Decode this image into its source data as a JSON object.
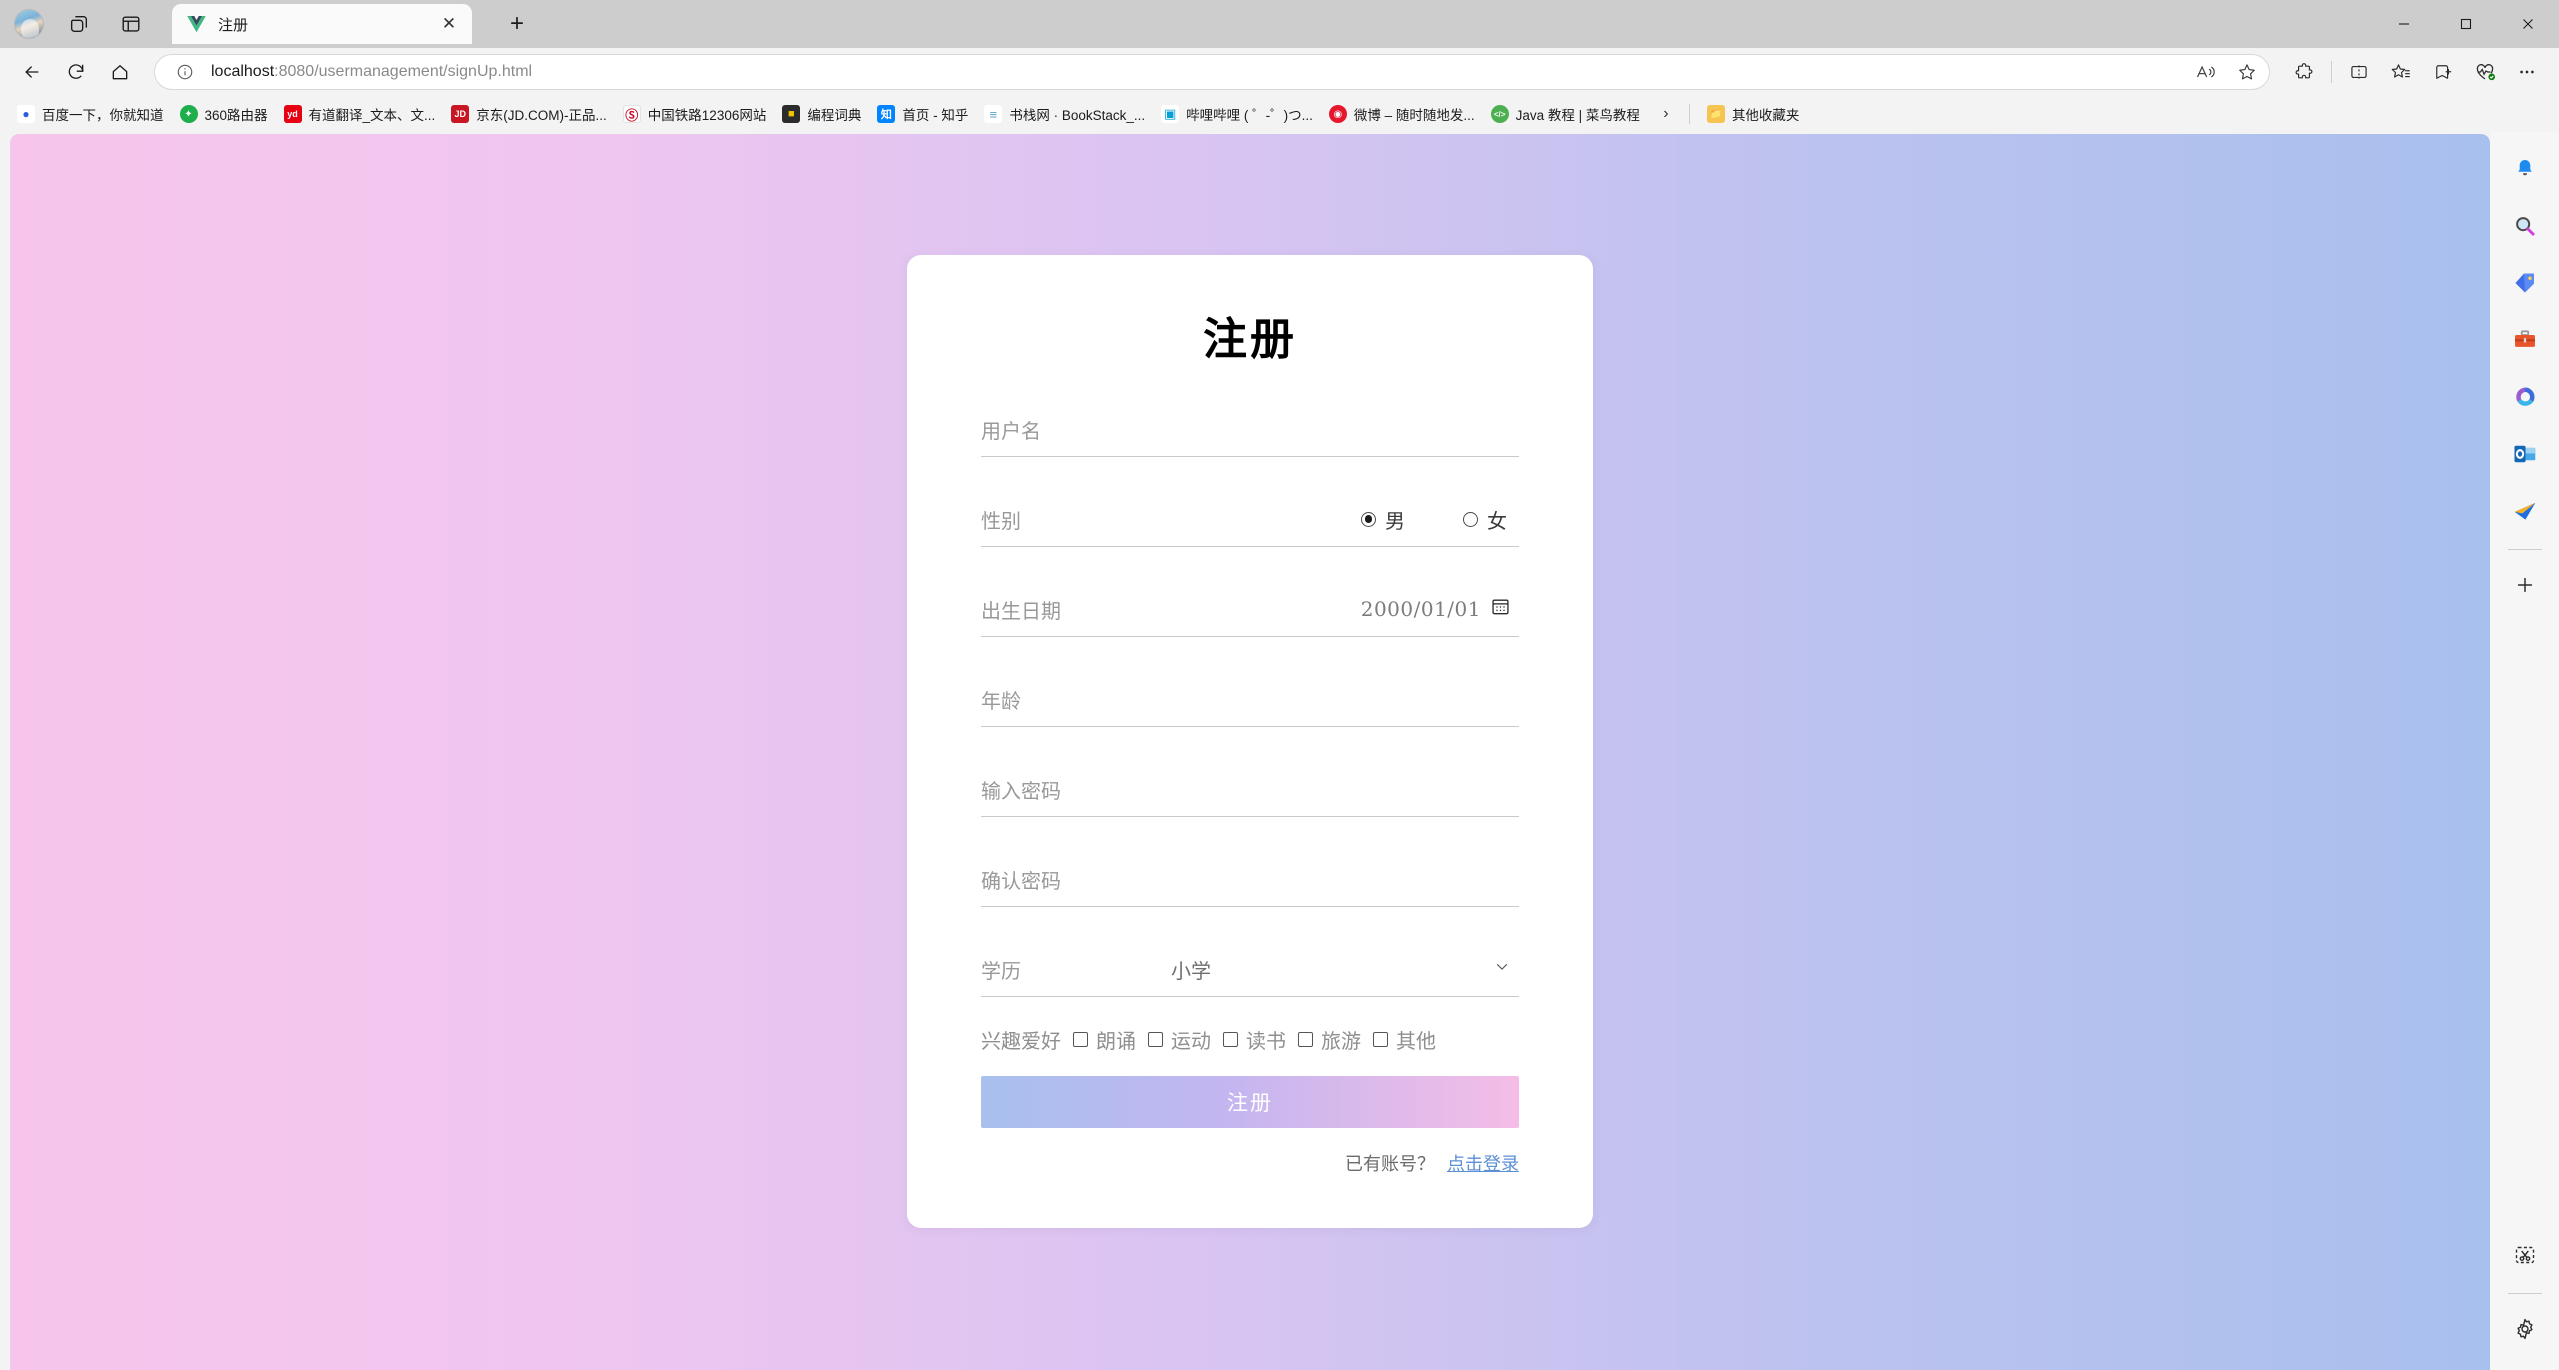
{
  "window": {
    "minimize_label": "—",
    "maximize_label": "❐",
    "close_label": "✕"
  },
  "tabstrip": {
    "profile_name": "profile-avatar",
    "tab_search_icon": "tab-copilot-icon",
    "split_panel_icon": "browser-essentials-icon",
    "tab": {
      "favicon": "vue-favicon",
      "title": "注册",
      "close_label": "✕"
    },
    "new_tab_label": "+"
  },
  "navbar": {
    "back_icon": "back-arrow-icon",
    "forward_icon": "forward-arrow-icon",
    "refresh_icon": "refresh-icon",
    "home_icon": "home-icon",
    "site_info_icon": "info-circle-icon",
    "url_host": "localhost",
    "url_path": ":8080/usermanagement/signUp.html",
    "read_aloud_icon": "read-aloud-icon",
    "favorite_icon": "star-icon",
    "extensions_icon": "extensions-puzzle-icon",
    "split_screen_icon": "split-screen-icon",
    "favorites_icon": "favorites-star-list-icon",
    "collections_icon": "collections-icon",
    "browser_health_icon": "browser-essentials-heart-icon",
    "settings_more_icon": "more-ellipsis-icon"
  },
  "bookmarks": {
    "items": [
      {
        "label": "百度一下，你就知道",
        "icon": "baidu-icon",
        "color": "#2b5fd9",
        "glyph": "百"
      },
      {
        "label": "360路由器",
        "icon": "360-icon",
        "color": "#1fae4c",
        "glyph": "✦"
      },
      {
        "label": "有道翻译_文本、文...",
        "icon": "youdao-icon",
        "color": "#e60012",
        "glyph": "yd"
      },
      {
        "label": "京东(JD.COM)-正品...",
        "icon": "jd-icon",
        "color": "#c81623",
        "glyph": "JD"
      },
      {
        "label": "中国铁路12306网站",
        "icon": "railway12306-icon",
        "color": "#ffffff",
        "glyph": "Ⓚ"
      },
      {
        "label": "编程词典",
        "icon": "programming-dictionary-icon",
        "color": "#2b2b2b",
        "glyph": "◧"
      },
      {
        "label": "首页 - 知乎",
        "icon": "zhihu-icon",
        "color": "#0084ff",
        "glyph": "知"
      },
      {
        "label": "书栈网 · BookStack_...",
        "icon": "bookstack-icon",
        "color": "#ffffff",
        "glyph": "≡"
      },
      {
        "label": "哔哩哔哩 ( ゜-゜)つ...",
        "icon": "bilibili-icon",
        "color": "#ffffff",
        "glyph": "□"
      },
      {
        "label": "微博 – 随时随地发...",
        "icon": "weibo-icon",
        "color": "#e6162d",
        "glyph": "◉"
      },
      {
        "label": "Java 教程 | 菜鸟教程",
        "icon": "runoob-icon",
        "color": "#4caf50",
        "glyph": "</>"
      }
    ],
    "overflow_label": "›",
    "other_favorites": {
      "label": "其他收藏夹",
      "icon": "folder-icon"
    }
  },
  "edgebar": {
    "notification_icon": "notification-bell-icon",
    "items": [
      {
        "icon": "search-magnifier-icon"
      },
      {
        "icon": "shopping-tag-icon"
      },
      {
        "icon": "tools-briefcase-icon"
      },
      {
        "icon": "microsoft-365-icon"
      },
      {
        "icon": "outlook-icon"
      },
      {
        "icon": "send-paperplane-icon"
      }
    ],
    "add_label": "+",
    "screenshot_icon": "web-capture-scissors-icon",
    "settings_icon": "settings-gear-icon"
  },
  "form": {
    "title": "注册",
    "username": {
      "label": "用户名",
      "value": ""
    },
    "gender": {
      "label": "性别",
      "options": [
        {
          "label": "男",
          "checked": true
        },
        {
          "label": "女",
          "checked": false
        }
      ]
    },
    "birthdate": {
      "label": "出生日期",
      "value": "2000/01/01",
      "calendar_icon": "calendar-icon"
    },
    "age": {
      "label": "年龄",
      "value": ""
    },
    "password": {
      "label": "输入密码",
      "value": ""
    },
    "confirm_password": {
      "label": "确认密码",
      "value": ""
    },
    "education": {
      "label": "学历",
      "selected": "小学",
      "chevron_icon": "chevron-down-icon"
    },
    "hobbies": {
      "label": "兴趣爱好",
      "items": [
        {
          "label": "朗诵",
          "checked": false
        },
        {
          "label": "运动",
          "checked": false
        },
        {
          "label": "读书",
          "checked": false
        },
        {
          "label": "旅游",
          "checked": false
        },
        {
          "label": "其他",
          "checked": false
        }
      ]
    },
    "submit_label": "注册",
    "footer": {
      "text": "已有账号？",
      "link": "点击登录"
    }
  },
  "colors": {
    "bg_left": "#f7c5ec",
    "bg_right": "#a8c0ee",
    "button_left": "#a8c0ee",
    "button_right": "#f4bde6",
    "link": "#5b8fd6"
  }
}
